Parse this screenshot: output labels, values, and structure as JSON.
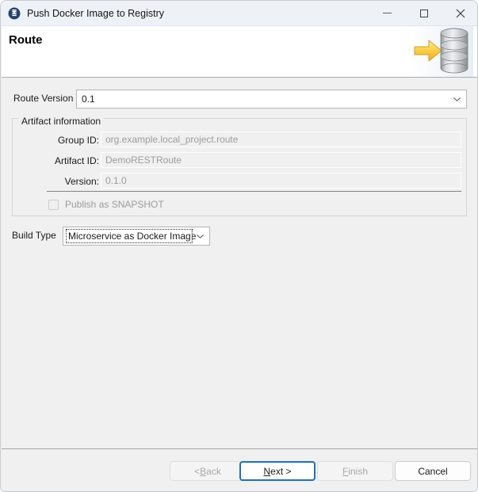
{
  "window": {
    "title": "Push Docker Image to Registry",
    "icon": "docker-registry-icon",
    "controls": {
      "minimize": "minimize-icon",
      "maximize": "maximize-icon",
      "close": "close-icon"
    }
  },
  "header": {
    "title": "Route",
    "icon": "database-push-icon",
    "accent_yellow": "#ffd24a",
    "accent_gray": "#b9bcbe"
  },
  "form": {
    "route_version": {
      "label": "Route Version",
      "value": "0.1"
    },
    "artifact_group": {
      "title": "Artifact information",
      "fields": [
        {
          "label": "Group ID:",
          "value": "org.example.local_project.route"
        },
        {
          "label": "Artifact ID:",
          "value": "DemoRESTRoute"
        },
        {
          "label": "Version:",
          "value": "0.1.0"
        }
      ],
      "checkbox": {
        "label": "Publish as SNAPSHOT",
        "checked": false
      }
    },
    "build_type": {
      "label": "Build Type",
      "value": "Microservice as Docker Image"
    }
  },
  "buttons": {
    "back": {
      "prefix": "< ",
      "mnemonic": "B",
      "suffix": "ack",
      "enabled": false
    },
    "next": {
      "prefix": "",
      "mnemonic": "N",
      "suffix": "ext >",
      "enabled": true,
      "default": true
    },
    "finish": {
      "prefix": "",
      "mnemonic": "F",
      "suffix": "inish",
      "enabled": false
    },
    "cancel": {
      "prefix": "",
      "mnemonic": "C",
      "suffix": "ancel",
      "enabled": true
    }
  },
  "colors": {
    "titlebar_bg": "#eef2f7",
    "body_bg": "#f0f0f0",
    "header_bg": "#ffffff",
    "default_button_border": "#1e70b8",
    "disabled_text": "#9c9c9c"
  }
}
